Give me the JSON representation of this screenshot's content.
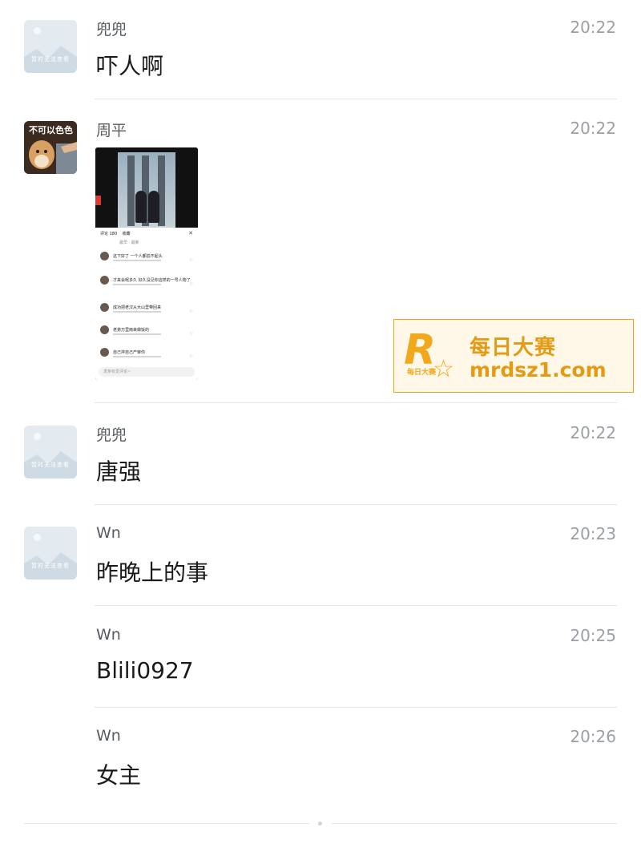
{
  "messages": [
    {
      "name": "兜兜",
      "time": "20:22",
      "text": "吓人啊",
      "avatar_text": "暂时无法查看"
    },
    {
      "name": "周平",
      "time": "20:22",
      "avatar_text": "不可以色色"
    },
    {
      "name": "兜兜",
      "time": "20:22",
      "text": "唐强",
      "avatar_text": "暂时无法查看"
    },
    {
      "name": "Wn",
      "time": "20:23",
      "text": "昨晚上的事",
      "avatar_text": "暂时无法查看"
    },
    {
      "name": "Wn",
      "time": "20:25",
      "text": "Blili0927"
    },
    {
      "name": "Wn",
      "time": "20:26",
      "text": "女主"
    }
  ],
  "screenshot": {
    "tab_comments": "评论 180",
    "tab_favorites": "收藏",
    "sort_label": "最早 · 最新",
    "comments": [
      "这下好了 一个人都拍不起头",
      "才来会呢多久 好久没见你这样的一号人物了",
      "成功把老汉从大山里带回来",
      "老弟万里雨来做饭的",
      "自己拌自己产审你"
    ],
    "input_placeholder": "发条有爱评论~"
  },
  "watermark": {
    "logo_letter": "R",
    "logo_small": "每日大赛",
    "cn_name": "每日大赛",
    "url": "mrdsz1.com"
  },
  "colors": {
    "accent": "#f2a81d",
    "name_gray": "#555b61",
    "time_gray": "#9aa0a6"
  }
}
